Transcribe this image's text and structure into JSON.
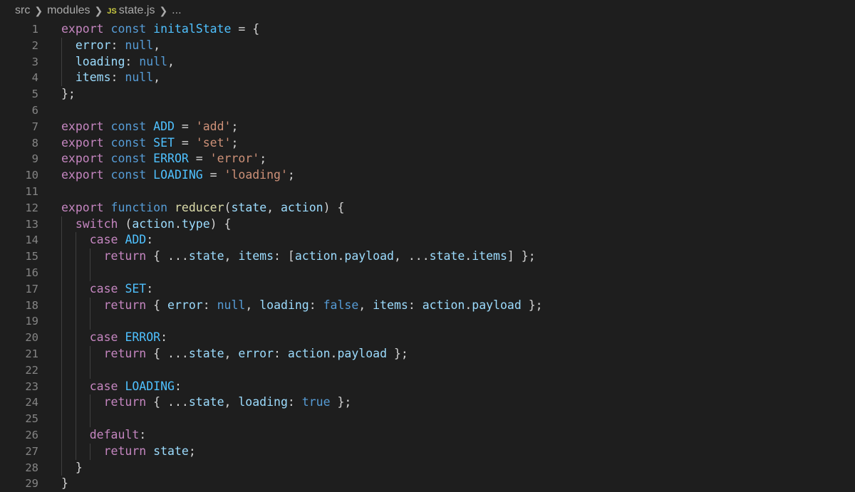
{
  "breadcrumb": {
    "seg1": "src",
    "seg2": "modules",
    "file_icon": "JS",
    "file": "state.js",
    "tail": "..."
  },
  "colors": {
    "background": "#1e1e1e",
    "keyword": "#c586c0",
    "storage": "#569cd6",
    "constant": "#4fc1ff",
    "property": "#9cdcfe",
    "string": "#ce9178",
    "function": "#dcdcaa",
    "plain": "#d4d4d4",
    "line_number": "#858585"
  },
  "lines": [
    {
      "n": "1",
      "tokens": [
        [
          "kw",
          "export"
        ],
        [
          "pl",
          " "
        ],
        [
          "st",
          "const"
        ],
        [
          "pl",
          " "
        ],
        [
          "var",
          "initalState"
        ],
        [
          "pl",
          " = {"
        ]
      ]
    },
    {
      "n": "2",
      "tokens": [
        [
          "pl",
          "  "
        ],
        [
          "prop",
          "error"
        ],
        [
          "pl",
          ": "
        ],
        [
          "st",
          "null"
        ],
        [
          "pl",
          ","
        ]
      ]
    },
    {
      "n": "3",
      "tokens": [
        [
          "pl",
          "  "
        ],
        [
          "prop",
          "loading"
        ],
        [
          "pl",
          ": "
        ],
        [
          "st",
          "null"
        ],
        [
          "pl",
          ","
        ]
      ]
    },
    {
      "n": "4",
      "tokens": [
        [
          "pl",
          "  "
        ],
        [
          "prop",
          "items"
        ],
        [
          "pl",
          ": "
        ],
        [
          "st",
          "null"
        ],
        [
          "pl",
          ","
        ]
      ]
    },
    {
      "n": "5",
      "tokens": [
        [
          "pl",
          "};"
        ]
      ]
    },
    {
      "n": "6",
      "tokens": []
    },
    {
      "n": "7",
      "tokens": [
        [
          "kw",
          "export"
        ],
        [
          "pl",
          " "
        ],
        [
          "st",
          "const"
        ],
        [
          "pl",
          " "
        ],
        [
          "var",
          "ADD"
        ],
        [
          "pl",
          " = "
        ],
        [
          "str",
          "'add'"
        ],
        [
          "pl",
          ";"
        ]
      ]
    },
    {
      "n": "8",
      "tokens": [
        [
          "kw",
          "export"
        ],
        [
          "pl",
          " "
        ],
        [
          "st",
          "const"
        ],
        [
          "pl",
          " "
        ],
        [
          "var",
          "SET"
        ],
        [
          "pl",
          " = "
        ],
        [
          "str",
          "'set'"
        ],
        [
          "pl",
          ";"
        ]
      ]
    },
    {
      "n": "9",
      "tokens": [
        [
          "kw",
          "export"
        ],
        [
          "pl",
          " "
        ],
        [
          "st",
          "const"
        ],
        [
          "pl",
          " "
        ],
        [
          "var",
          "ERROR"
        ],
        [
          "pl",
          " = "
        ],
        [
          "str",
          "'error'"
        ],
        [
          "pl",
          ";"
        ]
      ]
    },
    {
      "n": "10",
      "tokens": [
        [
          "kw",
          "export"
        ],
        [
          "pl",
          " "
        ],
        [
          "st",
          "const"
        ],
        [
          "pl",
          " "
        ],
        [
          "var",
          "LOADING"
        ],
        [
          "pl",
          " = "
        ],
        [
          "str",
          "'loading'"
        ],
        [
          "pl",
          ";"
        ]
      ]
    },
    {
      "n": "11",
      "tokens": []
    },
    {
      "n": "12",
      "tokens": [
        [
          "kw",
          "export"
        ],
        [
          "pl",
          " "
        ],
        [
          "st",
          "function"
        ],
        [
          "pl",
          " "
        ],
        [
          "fn",
          "reducer"
        ],
        [
          "pl",
          "("
        ],
        [
          "prop",
          "state"
        ],
        [
          "pl",
          ", "
        ],
        [
          "prop",
          "action"
        ],
        [
          "pl",
          ") {"
        ]
      ]
    },
    {
      "n": "13",
      "tokens": [
        [
          "pl",
          "  "
        ],
        [
          "kw",
          "switch"
        ],
        [
          "pl",
          " ("
        ],
        [
          "prop",
          "action"
        ],
        [
          "pl",
          "."
        ],
        [
          "prop",
          "type"
        ],
        [
          "pl",
          ") {"
        ]
      ]
    },
    {
      "n": "14",
      "tokens": [
        [
          "pl",
          "    "
        ],
        [
          "kw",
          "case"
        ],
        [
          "pl",
          " "
        ],
        [
          "var",
          "ADD"
        ],
        [
          "pl",
          ":"
        ]
      ]
    },
    {
      "n": "15",
      "tokens": [
        [
          "pl",
          "      "
        ],
        [
          "kw",
          "return"
        ],
        [
          "pl",
          " { ..."
        ],
        [
          "prop",
          "state"
        ],
        [
          "pl",
          ", "
        ],
        [
          "prop",
          "items"
        ],
        [
          "pl",
          ": ["
        ],
        [
          "prop",
          "action"
        ],
        [
          "pl",
          "."
        ],
        [
          "prop",
          "payload"
        ],
        [
          "pl",
          ", ..."
        ],
        [
          "prop",
          "state"
        ],
        [
          "pl",
          "."
        ],
        [
          "prop",
          "items"
        ],
        [
          "pl",
          "] };"
        ]
      ]
    },
    {
      "n": "16",
      "tokens": []
    },
    {
      "n": "17",
      "tokens": [
        [
          "pl",
          "    "
        ],
        [
          "kw",
          "case"
        ],
        [
          "pl",
          " "
        ],
        [
          "var",
          "SET"
        ],
        [
          "pl",
          ":"
        ]
      ]
    },
    {
      "n": "18",
      "tokens": [
        [
          "pl",
          "      "
        ],
        [
          "kw",
          "return"
        ],
        [
          "pl",
          " { "
        ],
        [
          "prop",
          "error"
        ],
        [
          "pl",
          ": "
        ],
        [
          "st",
          "null"
        ],
        [
          "pl",
          ", "
        ],
        [
          "prop",
          "loading"
        ],
        [
          "pl",
          ": "
        ],
        [
          "st",
          "false"
        ],
        [
          "pl",
          ", "
        ],
        [
          "prop",
          "items"
        ],
        [
          "pl",
          ": "
        ],
        [
          "prop",
          "action"
        ],
        [
          "pl",
          "."
        ],
        [
          "prop",
          "payload"
        ],
        [
          "pl",
          " };"
        ]
      ]
    },
    {
      "n": "19",
      "tokens": []
    },
    {
      "n": "20",
      "tokens": [
        [
          "pl",
          "    "
        ],
        [
          "kw",
          "case"
        ],
        [
          "pl",
          " "
        ],
        [
          "var",
          "ERROR"
        ],
        [
          "pl",
          ":"
        ]
      ]
    },
    {
      "n": "21",
      "tokens": [
        [
          "pl",
          "      "
        ],
        [
          "kw",
          "return"
        ],
        [
          "pl",
          " { ..."
        ],
        [
          "prop",
          "state"
        ],
        [
          "pl",
          ", "
        ],
        [
          "prop",
          "error"
        ],
        [
          "pl",
          ": "
        ],
        [
          "prop",
          "action"
        ],
        [
          "pl",
          "."
        ],
        [
          "prop",
          "payload"
        ],
        [
          "pl",
          " };"
        ]
      ]
    },
    {
      "n": "22",
      "tokens": []
    },
    {
      "n": "23",
      "tokens": [
        [
          "pl",
          "    "
        ],
        [
          "kw",
          "case"
        ],
        [
          "pl",
          " "
        ],
        [
          "var",
          "LOADING"
        ],
        [
          "pl",
          ":"
        ]
      ]
    },
    {
      "n": "24",
      "tokens": [
        [
          "pl",
          "      "
        ],
        [
          "kw",
          "return"
        ],
        [
          "pl",
          " { ..."
        ],
        [
          "prop",
          "state"
        ],
        [
          "pl",
          ", "
        ],
        [
          "prop",
          "loading"
        ],
        [
          "pl",
          ": "
        ],
        [
          "st",
          "true"
        ],
        [
          "pl",
          " };"
        ]
      ]
    },
    {
      "n": "25",
      "tokens": []
    },
    {
      "n": "26",
      "tokens": [
        [
          "pl",
          "    "
        ],
        [
          "kw",
          "default"
        ],
        [
          "pl",
          ":"
        ]
      ]
    },
    {
      "n": "27",
      "tokens": [
        [
          "pl",
          "      "
        ],
        [
          "kw",
          "return"
        ],
        [
          "pl",
          " "
        ],
        [
          "prop",
          "state"
        ],
        [
          "pl",
          ";"
        ]
      ]
    },
    {
      "n": "28",
      "tokens": [
        [
          "pl",
          "  }"
        ]
      ]
    },
    {
      "n": "29",
      "tokens": [
        [
          "pl",
          "}"
        ]
      ]
    }
  ]
}
